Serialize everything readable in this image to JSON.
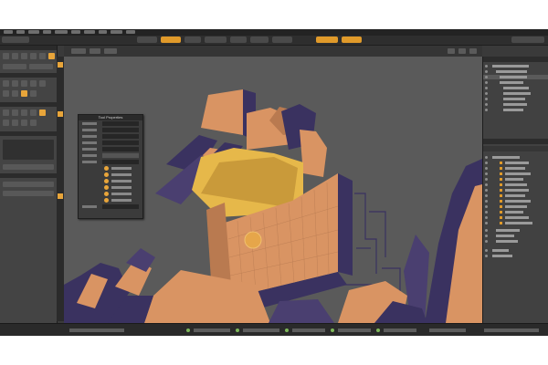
{
  "window": {
    "title": ""
  },
  "viewport": {
    "label": ""
  },
  "properties_panel": {
    "title": "Tool Properties"
  },
  "status_bar": {
    "caption": ""
  },
  "colors": {
    "accent": "#e09a2a",
    "model_fill": "#d99463",
    "model_shadow": "#3a3260",
    "viewport_bg": "#5a5a5a",
    "panel_bg": "#414141"
  },
  "icons": [
    "new-icon",
    "open-icon",
    "save-icon",
    "move-tool-icon",
    "rotate-tool-icon",
    "scale-tool-icon",
    "eye-icon",
    "gear-icon"
  ]
}
